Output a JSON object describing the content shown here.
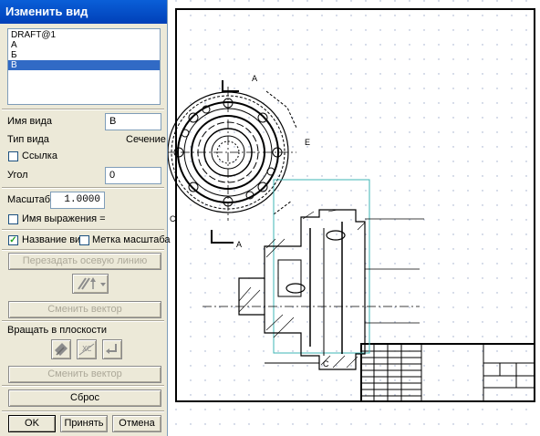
{
  "dialog": {
    "title": "Изменить вид",
    "views_list": [
      "DRAFT@1",
      "А",
      "Б",
      "В"
    ],
    "selected_index": 3,
    "view_name_label": "Имя вида",
    "view_name_value": "В",
    "view_type_label": "Тип вида",
    "view_type_value": "Сечение",
    "link_label": "Ссылка",
    "link_checked": false,
    "angle_label": "Угол",
    "angle_value": "0",
    "scale_label": "Масштаб",
    "scale_value": "1.0000",
    "expression_name_label": "Имя выражения =",
    "expression_name_checked": false,
    "view_name_chk_label": "Название вид",
    "view_name_chk_checked": true,
    "scale_mark_label": "Метка масштаба",
    "scale_mark_checked": false,
    "redefine_axis_button": "Перезадать осевую линию",
    "change_vector_button_1": "Сменить вектор",
    "rotate_in_plane_label": "Вращать в плоскости",
    "change_vector_button_2": "Сменить вектор",
    "reset_button": "Сброс",
    "ok_button": "OK",
    "apply_button": "Принять",
    "cancel_button": "Отмена"
  },
  "drawing": {
    "section_labels": [
      "А",
      "А",
      "Е",
      "С",
      "С"
    ],
    "accent_color": "#3cb4b4",
    "selection_color": "#316ac5"
  }
}
